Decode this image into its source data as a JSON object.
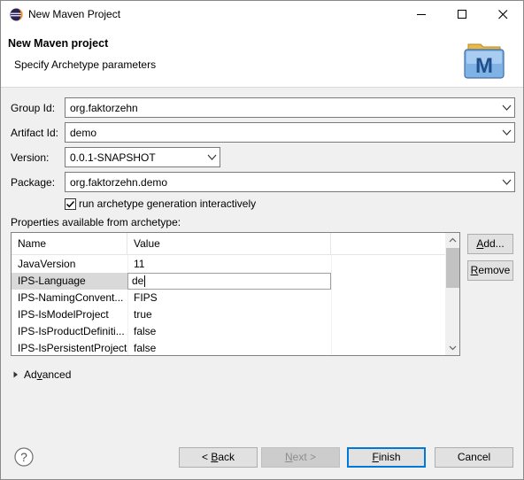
{
  "window": {
    "title": "New Maven Project"
  },
  "header": {
    "title": "New Maven project",
    "subtitle": "Specify Archetype parameters",
    "logo_letter": "M"
  },
  "form": {
    "group_id": {
      "label": "Group Id:",
      "value": "org.faktorzehn"
    },
    "artifact_id": {
      "label": "Artifact Id:",
      "value": "demo"
    },
    "version": {
      "label": "Version:",
      "value": "0.0.1-SNAPSHOT"
    },
    "package": {
      "label": "Package:",
      "value": "org.faktorzehn.demo"
    },
    "interactive": {
      "label": "run archetype generation interactively",
      "checked": true
    }
  },
  "properties": {
    "label": "Properties available from archetype:",
    "columns": [
      "Name",
      "Value"
    ],
    "rows": [
      {
        "name": "JavaVersion",
        "value": "11"
      },
      {
        "name": "IPS-Language",
        "value": "de"
      },
      {
        "name": "IPS-NamingConvent...",
        "value": "FIPS"
      },
      {
        "name": "IPS-IsModelProject",
        "value": "true"
      },
      {
        "name": "IPS-IsProductDefiniti...",
        "value": "false"
      },
      {
        "name": "IPS-IsPersistentProject",
        "value": "false"
      }
    ],
    "add_label": "Add...",
    "remove_label": "Remove"
  },
  "advanced": {
    "label": "Advanced"
  },
  "buttons": {
    "back": "< Back",
    "next": "Next >",
    "finish": "Finish",
    "cancel": "Cancel"
  },
  "icons": [
    "eclipse-icon",
    "minimize-icon",
    "maximize-icon",
    "close-icon",
    "maven-logo-icon",
    "dropdown-arrow-icon",
    "checkbox-check-icon",
    "expand-arrow-icon",
    "help-icon"
  ],
  "colors": {
    "accent": "#0078d7",
    "window_bg": "#f0f0f0",
    "selection": "#d9d9d9"
  }
}
